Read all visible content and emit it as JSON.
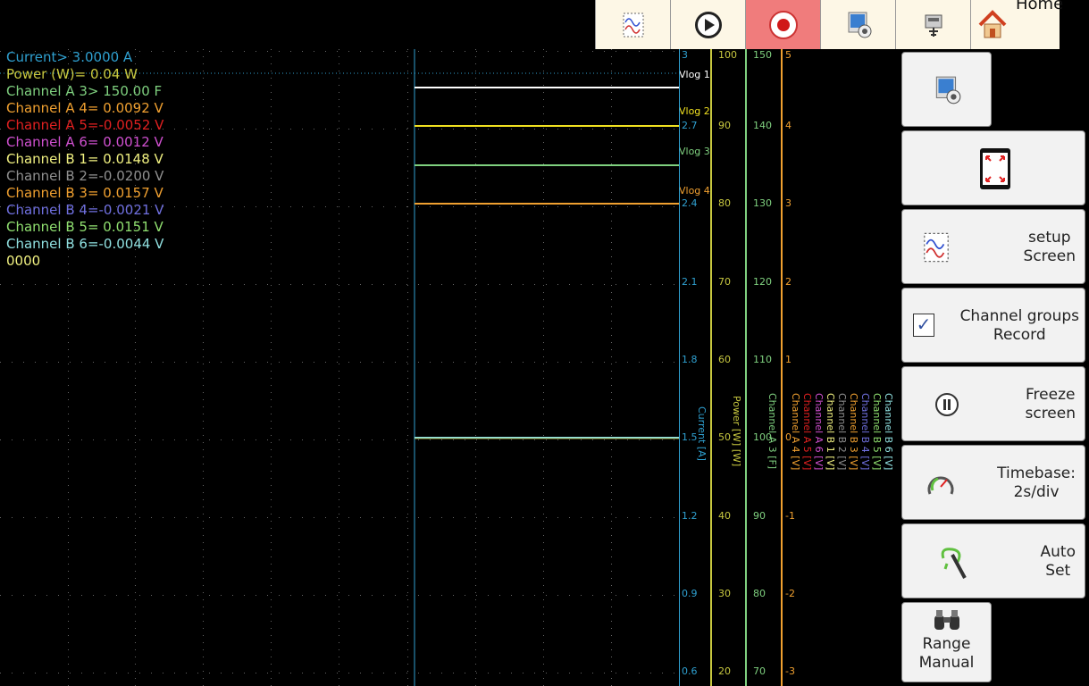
{
  "toolbar": {
    "home_label": "Home"
  },
  "readouts": [
    {
      "text": "Current> 3.0000 A",
      "color": "#2fa0d0"
    },
    {
      "text": "Power (W)=   0.04 W",
      "color": "#c8c840"
    },
    {
      "text": "Channel A 3> 150.00 F",
      "color": "#7fd07f"
    },
    {
      "text": "Channel A 4= 0.0092 V",
      "color": "#f0a030"
    },
    {
      "text": "Channel A 5=-0.0052 V",
      "color": "#e02020"
    },
    {
      "text": "Channel A 6= 0.0012 V",
      "color": "#d050d0"
    },
    {
      "text": "Channel B 1= 0.0148 V",
      "color": "#f0f080"
    },
    {
      "text": "Channel B 2=-0.0200 V",
      "color": "#909090"
    },
    {
      "text": "Channel B 3= 0.0157 V",
      "color": "#f0a030"
    },
    {
      "text": "Channel B 4=-0.0021 V",
      "color": "#7070e0"
    },
    {
      "text": "Channel B 5= 0.0151 V",
      "color": "#90e070"
    },
    {
      "text": "Channel B 6=-0.0044 V",
      "color": "#90e0e0"
    },
    {
      "text": "0000",
      "color": "#f0f080"
    }
  ],
  "vlog_labels": [
    {
      "text": "Vlog 1",
      "color": "#ffffff"
    },
    {
      "text": "Vlog 2",
      "color": "#f0e020"
    },
    {
      "text": "Vlog 3",
      "color": "#7fd07f"
    },
    {
      "text": "Vlog 4",
      "color": "#f0a030"
    }
  ],
  "axes": {
    "current": {
      "label": "Current [A]",
      "color": "#2fa0d0",
      "ticks": [
        "3",
        "2.7",
        "2.4",
        "2.1",
        "1.8",
        "1.5",
        "1.2",
        "0.9",
        "0.6"
      ]
    },
    "power": {
      "label": "Power [W] [W]",
      "color": "#c8c840",
      "ticks": [
        "100",
        "90",
        "80",
        "70",
        "60",
        "50",
        "40",
        "30",
        "20"
      ]
    },
    "channel_a3": {
      "label": "Channel A 3 [F]",
      "color": "#7fd07f",
      "ticks": [
        "150",
        "140",
        "130",
        "120",
        "110",
        "100",
        "90",
        "80",
        "70"
      ]
    },
    "channel_v": {
      "color": "#f0a030",
      "ticks": [
        "5",
        "4",
        "3",
        "2",
        "1",
        "0",
        "-1",
        "-2",
        "-3"
      ]
    }
  },
  "channel_axis_labels": [
    {
      "text": "Channel A 4 [V]",
      "color": "#f0a030"
    },
    {
      "text": "Channel A 5 [V]",
      "color": "#e02020"
    },
    {
      "text": "Channel A 6 [V]",
      "color": "#d050d0"
    },
    {
      "text": "Channel B 1 [V]",
      "color": "#f0f080"
    },
    {
      "text": "Channel B 2 [V]",
      "color": "#909090"
    },
    {
      "text": "Channel B 3 [V]",
      "color": "#f0a030"
    },
    {
      "text": "Channel B 4 [V]",
      "color": "#7070e0"
    },
    {
      "text": "Channel B 5 [V]",
      "color": "#90e070"
    },
    {
      "text": "Channel B 6 [V]",
      "color": "#90e0e0"
    }
  ],
  "panel": {
    "setup_screen": "setup\nScreen",
    "channel_groups": "Channel groups\nRecord",
    "freeze_screen": "Freeze\nscreen",
    "timebase": "Timebase:\n2s/div",
    "auto_set": "Auto\nSet",
    "range_manual": "Range\nManual"
  }
}
